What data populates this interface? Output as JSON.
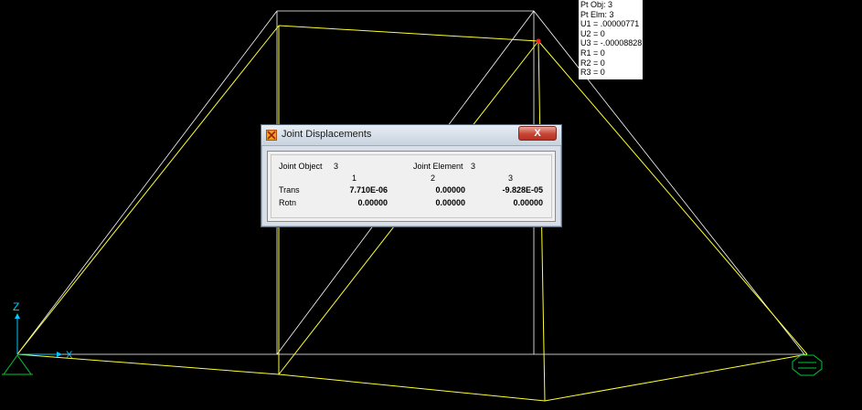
{
  "info_box": {
    "lines": [
      "Pt Obj: 3",
      "Pt Elm: 3",
      "U1 = .00000771",
      "U2 = 0",
      "U3 = -.00008828",
      "R1 = 0",
      "R2 = 0",
      "R3 = 0"
    ]
  },
  "axes": {
    "z_label": "Z",
    "x_label": "X",
    "axis_color": "#00c8ff"
  },
  "dialog": {
    "title": "Joint Displacements",
    "close_label": "X",
    "joint_object_label": "Joint Object",
    "joint_object_value": "3",
    "joint_element_label": "Joint Element",
    "joint_element_value": "3",
    "columns": [
      "1",
      "2",
      "3"
    ],
    "rows": [
      {
        "label": "Trans",
        "values": [
          "7.710E-06",
          "0.00000",
          "-9.828E-05"
        ]
      },
      {
        "label": "Rotn",
        "values": [
          "0.00000",
          "0.00000",
          "0.00000"
        ]
      }
    ]
  },
  "colors": {
    "undeformed": "#ffffff",
    "deformed": "#ffff33",
    "support": "#00c832",
    "selected_joint": "#ff2020"
  }
}
